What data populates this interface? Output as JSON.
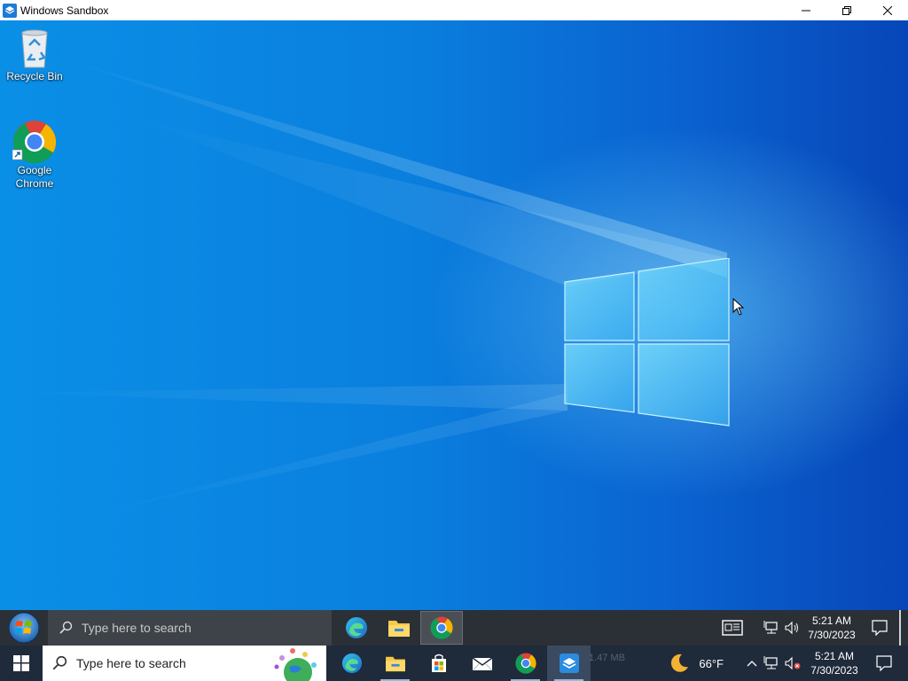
{
  "window": {
    "title": "Windows Sandbox"
  },
  "desktop": {
    "icons": [
      {
        "label": "Recycle Bin"
      },
      {
        "label": "Google Chrome"
      }
    ]
  },
  "inner_taskbar": {
    "search_placeholder": "Type here to search",
    "apps": [
      "edge-icon",
      "file-explorer-icon",
      "chrome-icon"
    ],
    "clock": {
      "time": "5:21 AM",
      "date": "7/30/2023"
    }
  },
  "outer_taskbar": {
    "search_placeholder": "Type here to search",
    "apps": [
      "edge-icon",
      "file-explorer-icon",
      "microsoft-store-icon",
      "mail-icon",
      "chrome-icon",
      "windows-sandbox-icon"
    ],
    "ghost_text_size": "1.47 MB",
    "weather": {
      "temp": "66°F",
      "icon": "moon-icon"
    },
    "clock": {
      "time": "5:21 AM",
      "date": "7/30/2023"
    }
  },
  "colors": {
    "desktop_blue": "#0a7fde",
    "taskbar_dark": "#2b3036",
    "host_taskbar": "#1f2a3a"
  }
}
